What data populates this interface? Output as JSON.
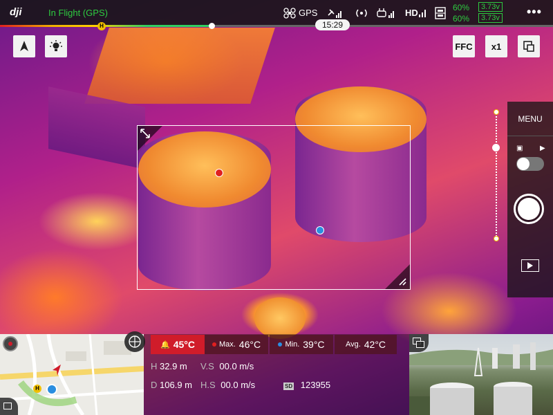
{
  "status": {
    "brand": "dji",
    "flight_mode": "In Flight (GPS)",
    "gps_label": "GPS",
    "hd_label": "HD",
    "battery": [
      {
        "percent": "60%",
        "voltage": "3.73v"
      },
      {
        "percent": "60%",
        "voltage": "3.73v"
      }
    ],
    "time_remaining": "15:29",
    "flight_progress": 0.38,
    "home_marker": "H"
  },
  "camera_tools": {
    "ffc_label": "FFC",
    "zoom_label": "x1"
  },
  "right_panel": {
    "menu_label": "MENU"
  },
  "measurements": {
    "alarm_temp": "45°C",
    "max_label": "Max.",
    "max_temp": "46°C",
    "min_label": "Min.",
    "min_temp": "39°C",
    "avg_label": "Avg.",
    "avg_temp": "42°C"
  },
  "telemetry": {
    "h_label": "H",
    "h_value": "32.9 m",
    "vs_label": "V.S",
    "vs_value": "00.0 m/s",
    "d_label": "D",
    "d_value": "106.9 m",
    "hs_label": "H.S",
    "hs_value": "00.0 m/s",
    "sd_label": "SD",
    "sd_value": "123955"
  },
  "map": {
    "home_marker": "H"
  },
  "colors": {
    "flight_mode_green": "#2ecc40",
    "alarm_red": "#d01c2a",
    "max_dot": "#e02020",
    "min_dot": "#2a8ee0",
    "accent_yellow": "#f0c000"
  },
  "icons": [
    "compass-icon",
    "light-bulb-icon",
    "drone-icon",
    "satellite-icon",
    "signal-icon",
    "remote-controller-icon",
    "battery-icon",
    "more-icon",
    "expand-arrows-icon",
    "resize-handle-icon",
    "photo-mode-icon",
    "video-mode-icon",
    "shutter-button-icon",
    "playback-icon",
    "globe-icon",
    "switch-view-icon",
    "alarm-bell-icon",
    "sd-card-icon"
  ]
}
